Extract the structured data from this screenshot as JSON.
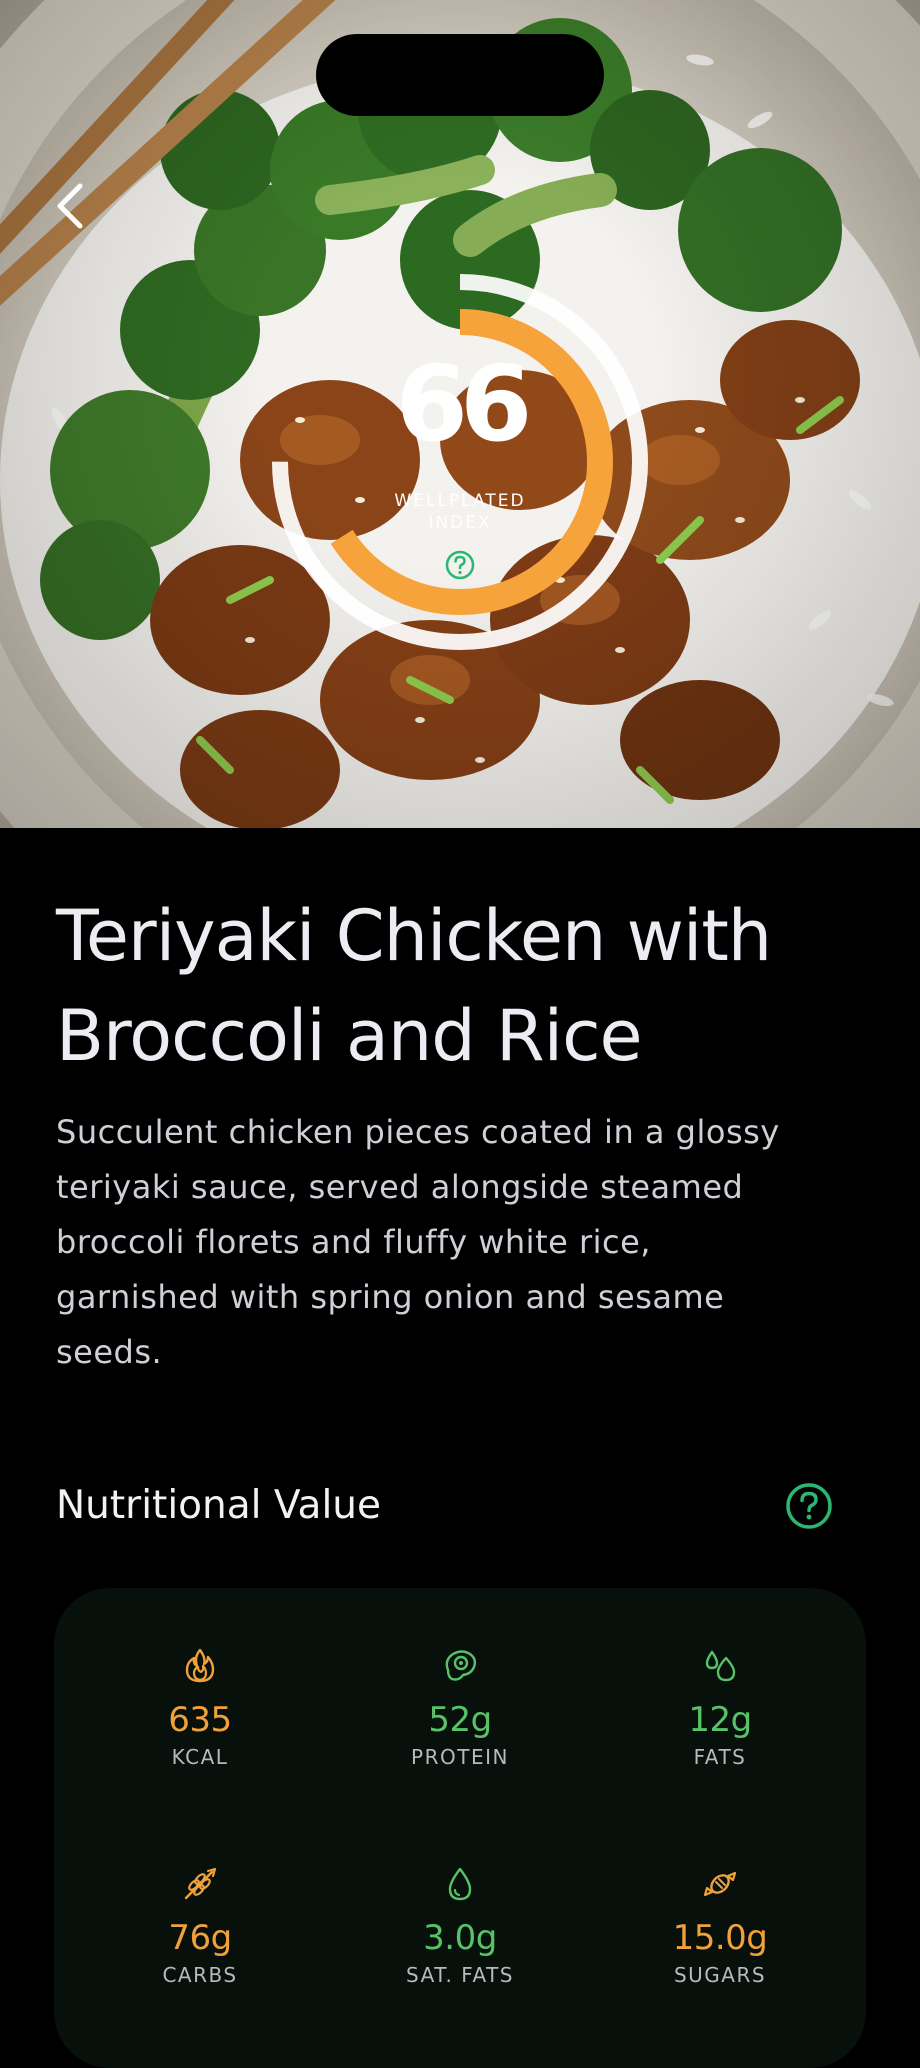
{
  "score": {
    "value": "66",
    "label_line1": "WELLPLATED",
    "label_line2": "INDEX",
    "fraction": 0.66
  },
  "recipe": {
    "title_line1": "Teriyaki Chicken with",
    "title_line2": "Broccoli and Rice",
    "description_lines": [
      "Succulent chicken pieces coated in a glossy",
      "teriyaki sauce, served alongside steamed",
      "broccoli florets and fluffy white rice,",
      "garnished with spring onion and sesame",
      "seeds."
    ]
  },
  "nutrition": {
    "section_title": "Nutritional Value",
    "items": [
      {
        "value": "635",
        "label": "KCAL",
        "icon": "flame-icon",
        "tone": "orange"
      },
      {
        "value": "52g",
        "label": "PROTEIN",
        "icon": "steak-icon",
        "tone": "green"
      },
      {
        "value": "12g",
        "label": "FATS",
        "icon": "drops-icon",
        "tone": "green"
      },
      {
        "value": "76g",
        "label": "CARBS",
        "icon": "wheat-icon",
        "tone": "orange"
      },
      {
        "value": "3.0g",
        "label": "SAT. FATS",
        "icon": "drop-icon",
        "tone": "green"
      },
      {
        "value": "15.0g",
        "label": "SUGARS",
        "icon": "candy-icon",
        "tone": "orange"
      }
    ]
  },
  "colors": {
    "orange": "#f6a33b",
    "green": "#2bb673",
    "nutrient_green": "#57c267",
    "background": "#000000",
    "card": "#07100b"
  }
}
